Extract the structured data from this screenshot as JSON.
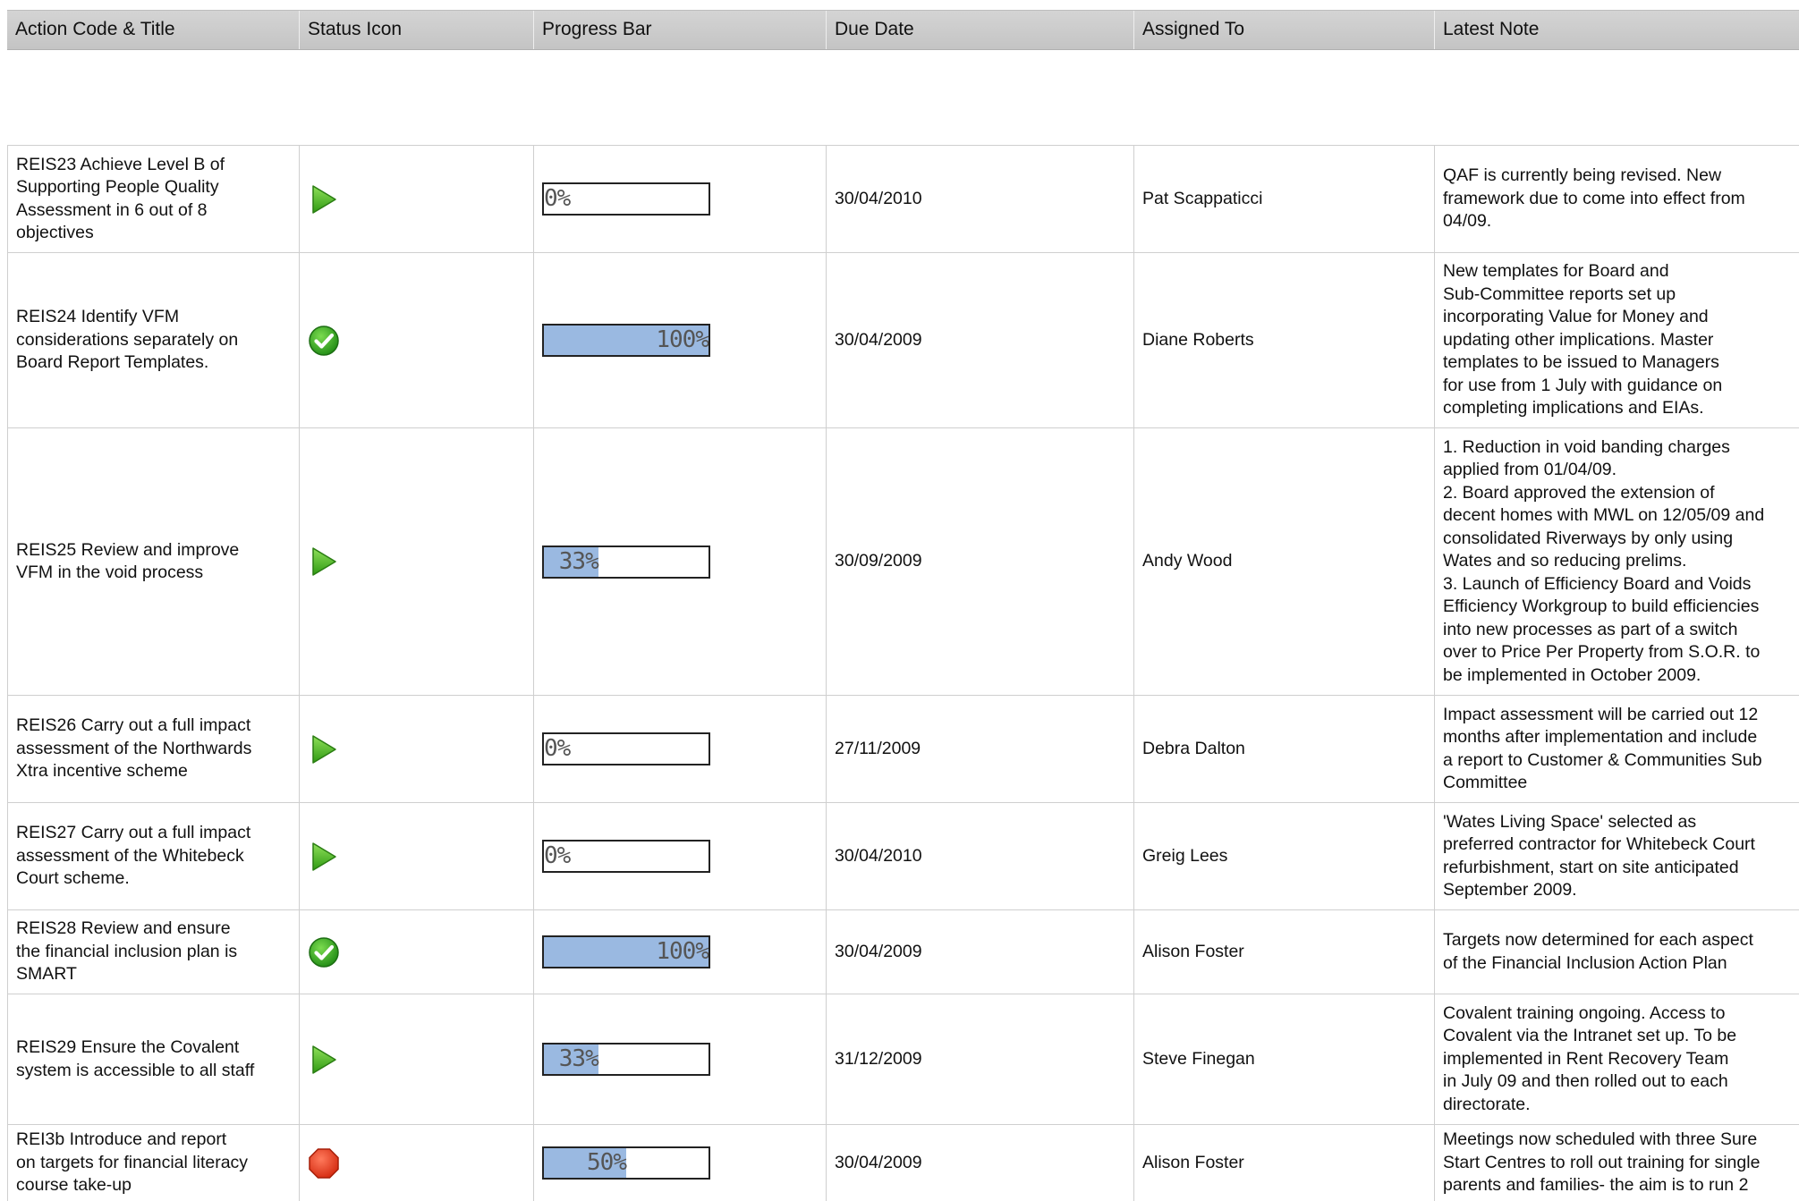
{
  "columns": [
    "Action Code & Title",
    "Status Icon",
    "Progress Bar",
    "Due Date",
    "Assigned To",
    "Latest Note"
  ],
  "rows": [
    {
      "title": "REIS23 Achieve Level B of\nSupporting People Quality\nAssessment in 6 out of 8\nobjectives",
      "status": "play-icon",
      "progress": 0,
      "progress_label": "0%",
      "due": "30/04/2010",
      "assigned": "Pat Scappaticci",
      "note": "QAF is currently being revised. New\nframework due to come into effect from\n04/09."
    },
    {
      "title": "REIS24 Identify VFM\nconsiderations separately on\nBoard Report Templates.",
      "status": "check-icon",
      "progress": 100,
      "progress_label": "100%",
      "due": "30/04/2009",
      "assigned": "Diane Roberts",
      "note": "New templates for Board and\nSub-Committee reports set up\nincorporating Value for Money and\nupdating other implications. Master\ntemplates to be issued to Managers\nfor use from 1 July with guidance on\ncompleting implications and EIAs."
    },
    {
      "title": "REIS25 Review and improve\nVFM in the void process",
      "status": "play-icon",
      "progress": 33,
      "progress_label": "33%",
      "due": "30/09/2009",
      "assigned": "Andy Wood",
      "note": "1. Reduction in void banding charges\napplied from 01/04/09.\n2. Board approved the extension of\ndecent homes with MWL on 12/05/09 and\nconsolidated Riverways by only using\nWates and so reducing prelims.\n3. Launch of Efficiency Board and Voids\nEfficiency Workgroup to build efficiencies\ninto new processes as part of a switch\nover to Price Per Property from S.O.R. to\nbe implemented in October 2009."
    },
    {
      "title": "REIS26 Carry out a full impact\nassessment of the Northwards\nXtra incentive scheme",
      "status": "play-icon",
      "progress": 0,
      "progress_label": "0%",
      "due": "27/11/2009",
      "assigned": "Debra Dalton",
      "note": "Impact assessment will be carried out 12\nmonths after implementation and include\na report to Customer & Communities Sub\nCommittee"
    },
    {
      "title": "REIS27 Carry out a full impact\nassessment of the Whitebeck\nCourt scheme.",
      "status": "play-icon",
      "progress": 0,
      "progress_label": "0%",
      "due": "30/04/2010",
      "assigned": "Greig Lees",
      "note": "'Wates Living Space' selected as\npreferred contractor for Whitebeck Court\nrefurbishment, start on site anticipated\nSeptember 2009."
    },
    {
      "title": "REIS28 Review and ensure\nthe financial inclusion plan is\nSMART",
      "status": "check-icon",
      "progress": 100,
      "progress_label": "100%",
      "due": "30/04/2009",
      "assigned": "Alison Foster",
      "note": "Targets now determined for each aspect\nof the Financial Inclusion Action Plan"
    },
    {
      "title": "REIS29 Ensure the Covalent\nsystem is accessible to all staff",
      "status": "play-icon",
      "progress": 33,
      "progress_label": "33%",
      "due": "31/12/2009",
      "assigned": "Steve Finegan",
      "note": "Covalent training ongoing. Access to\nCovalent via the Intranet set up. To be\nimplemented in Rent Recovery Team\nin July 09 and then rolled out to each\ndirectorate."
    },
    {
      "title": "REI3b Introduce and report\non targets for financial literacy\ncourse take-up",
      "status": "stop-icon",
      "progress": 50,
      "progress_label": "50%",
      "due": "30/04/2009",
      "assigned": "Alison Foster",
      "note": "Meetings now scheduled with three Sure\nStart Centres to roll out training for single\nparents and families- the aim is to run 2"
    }
  ],
  "colors": {
    "header_bg": "#c8c8c8",
    "progress_fill": "#9ab9e1",
    "play_icon": "#4caf24",
    "check_icon": "#2e9e1e",
    "stop_icon": "#e2321c"
  }
}
